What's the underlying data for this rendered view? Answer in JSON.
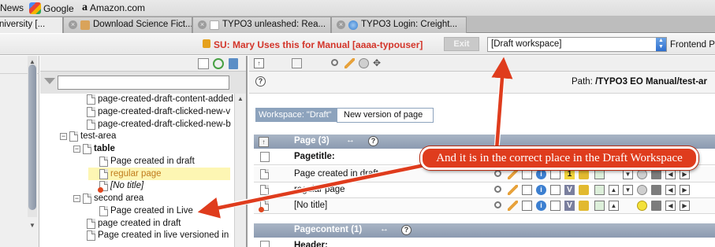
{
  "bookmarks": [
    {
      "label": "News",
      "icon": "none"
    },
    {
      "label": "Google",
      "icon": "google-icon"
    },
    {
      "label": "Amazon.com",
      "icon": "amazon-icon"
    }
  ],
  "tabs": [
    {
      "label": "niversity [...",
      "active": true
    },
    {
      "label": "Download Science Fict...",
      "active": false
    },
    {
      "label": "TYPO3 unleashed: Rea...",
      "active": false
    },
    {
      "label": "TYPO3 Login: Creight...",
      "active": false
    }
  ],
  "su_bar": {
    "su_text": "SU:  Mary Uses this for Manual [aaaa-typouser]",
    "exit_label": "Exit",
    "workspace_selected": "[Draft workspace]",
    "frontend_label": "Frontend Pr"
  },
  "tree": {
    "items": [
      {
        "label": "page-created-draft-content-added",
        "indent": 2
      },
      {
        "label": "page-created-draft-clicked-new-v",
        "indent": 2
      },
      {
        "label": "page-created-draft-clicked-new-b",
        "indent": 2
      },
      {
        "label": "test-area",
        "indent": 1,
        "toggle": "−"
      },
      {
        "label": "table",
        "indent": 2,
        "toggle": "−",
        "bold": true
      },
      {
        "label": "Page created in draft",
        "indent": 3
      },
      {
        "label": "regular page",
        "indent": 3,
        "highlight": true,
        "color": "#c07c1c"
      },
      {
        "label": "[No title]",
        "indent": 3,
        "italic": true,
        "red": true
      },
      {
        "label": "second area",
        "indent": 2,
        "toggle": "−"
      },
      {
        "label": "Page created in Live",
        "indent": 3
      },
      {
        "label": "page created in draft",
        "indent": 2
      },
      {
        "label": "Page created in live versioned in",
        "indent": 2
      }
    ]
  },
  "content": {
    "path_label": "Path:",
    "path_value": "/TYPO3 EO Manual/test-ar",
    "workspace_tag": "Workspace: \"Draft\"",
    "workspace_version": "New version of page",
    "page_section": "Page (3)",
    "page_rows": [
      {
        "label": "Pagetitle:",
        "bold": true
      },
      {
        "label": "Page created in draft"
      },
      {
        "label": "regular page"
      },
      {
        "label": "[No title]"
      }
    ],
    "pagecontent_section": "Pagecontent (1)",
    "header_label": "Header:"
  },
  "annotation": {
    "text": "And it is in the correct place in the Draft Workspace",
    "color": "#df3c1d"
  }
}
